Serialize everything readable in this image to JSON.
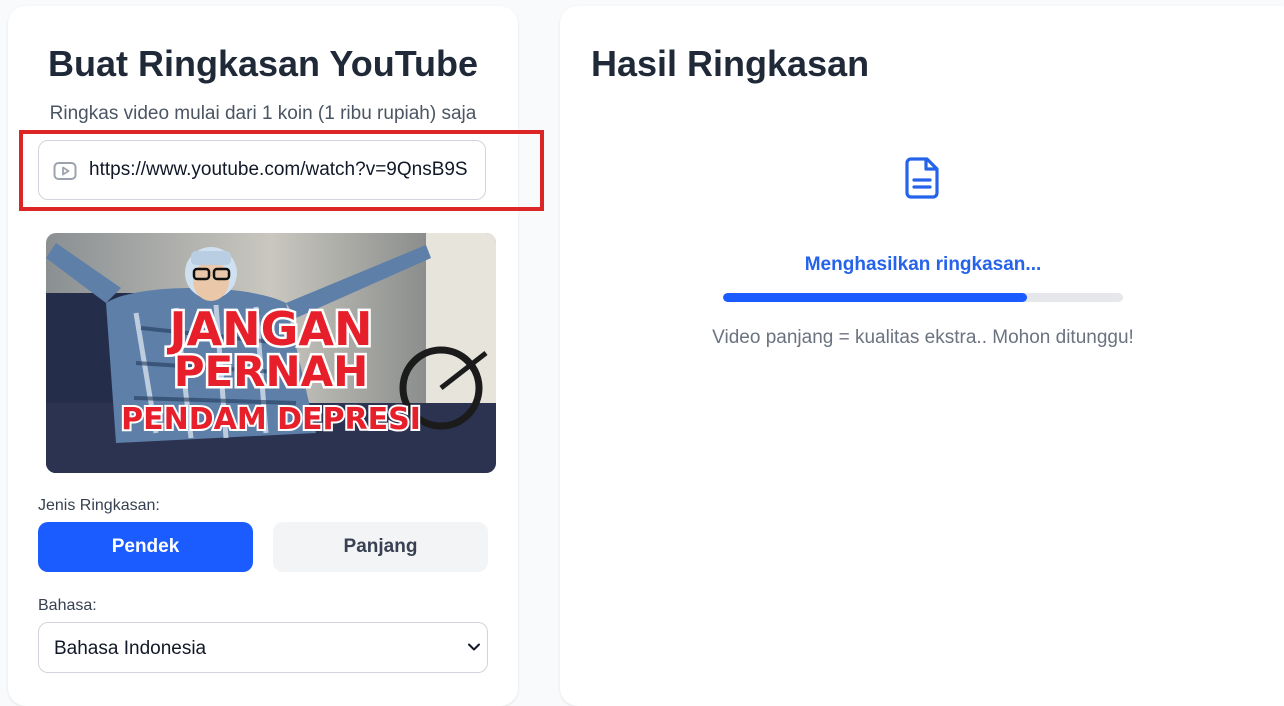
{
  "left": {
    "title": "Buat Ringkasan YouTube",
    "subtitle": "Ringkas video mulai dari 1 koin (1 ribu rupiah) saja",
    "url_input": {
      "value": "https://www.youtube.com/watch?v=9QnsB9S",
      "icon": "youtube-play-icon"
    },
    "thumbnail": {
      "line1": "JANGAN",
      "line2": "PERNAH",
      "line3": "PENDAM DEPRESI"
    },
    "summary_type": {
      "label": "Jenis Ringkasan:",
      "options": [
        "Pendek",
        "Panjang"
      ],
      "selected": "Pendek"
    },
    "language": {
      "label": "Bahasa:",
      "selected": "Bahasa Indonesia"
    }
  },
  "right": {
    "title": "Hasil Ringkasan",
    "status": "Menghasilkan ringkasan...",
    "progress": 0.76,
    "note": "Video panjang = kualitas ekstra.. Mohon ditunggu!",
    "icon": "document-icon"
  },
  "colors": {
    "accent": "#1a5cff",
    "status_text": "#2563eb",
    "highlight": "#dc2626"
  }
}
